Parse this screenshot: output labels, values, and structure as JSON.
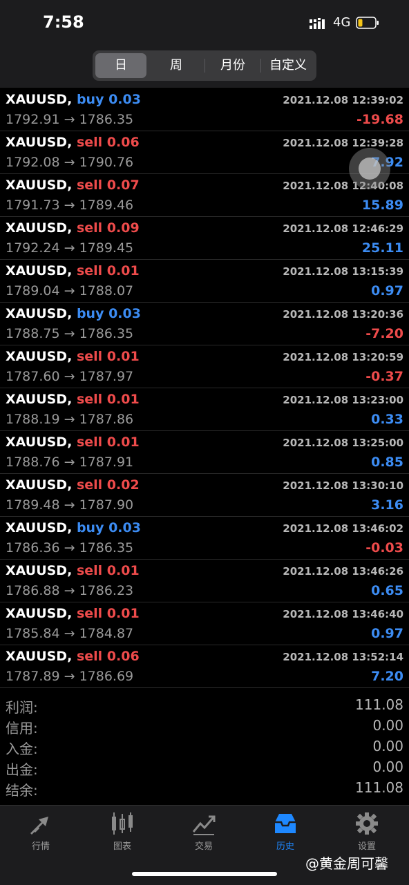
{
  "status": {
    "time": "7:58",
    "network": "4G"
  },
  "tabs_top": [
    "日",
    "周",
    "月份",
    "自定义"
  ],
  "trades": [
    {
      "symbol": "XAUUSD,",
      "side": "buy",
      "volume": "0.03",
      "time": "2021.12.08 12:39:02",
      "prices": "1792.91 → 1786.35",
      "profit": "-19.68"
    },
    {
      "symbol": "XAUUSD,",
      "side": "sell",
      "volume": "0.06",
      "time": "2021.12.08 12:39:28",
      "prices": "1792.08 → 1790.76",
      "profit": "7.92"
    },
    {
      "symbol": "XAUUSD,",
      "side": "sell",
      "volume": "0.07",
      "time": "2021.12.08 12:40:08",
      "prices": "1791.73 → 1789.46",
      "profit": "15.89"
    },
    {
      "symbol": "XAUUSD,",
      "side": "sell",
      "volume": "0.09",
      "time": "2021.12.08 12:46:29",
      "prices": "1792.24 → 1789.45",
      "profit": "25.11"
    },
    {
      "symbol": "XAUUSD,",
      "side": "sell",
      "volume": "0.01",
      "time": "2021.12.08 13:15:39",
      "prices": "1789.04 → 1788.07",
      "profit": "0.97"
    },
    {
      "symbol": "XAUUSD,",
      "side": "buy",
      "volume": "0.03",
      "time": "2021.12.08 13:20:36",
      "prices": "1788.75 → 1786.35",
      "profit": "-7.20"
    },
    {
      "symbol": "XAUUSD,",
      "side": "sell",
      "volume": "0.01",
      "time": "2021.12.08 13:20:59",
      "prices": "1787.60 → 1787.97",
      "profit": "-0.37"
    },
    {
      "symbol": "XAUUSD,",
      "side": "sell",
      "volume": "0.01",
      "time": "2021.12.08 13:23:00",
      "prices": "1788.19 → 1787.86",
      "profit": "0.33"
    },
    {
      "symbol": "XAUUSD,",
      "side": "sell",
      "volume": "0.01",
      "time": "2021.12.08 13:25:00",
      "prices": "1788.76 → 1787.91",
      "profit": "0.85"
    },
    {
      "symbol": "XAUUSD,",
      "side": "sell",
      "volume": "0.02",
      "time": "2021.12.08 13:30:10",
      "prices": "1789.48 → 1787.90",
      "profit": "3.16"
    },
    {
      "symbol": "XAUUSD,",
      "side": "buy",
      "volume": "0.03",
      "time": "2021.12.08 13:46:02",
      "prices": "1786.36 → 1786.35",
      "profit": "-0.03"
    },
    {
      "symbol": "XAUUSD,",
      "side": "sell",
      "volume": "0.01",
      "time": "2021.12.08 13:46:26",
      "prices": "1786.88 → 1786.23",
      "profit": "0.65"
    },
    {
      "symbol": "XAUUSD,",
      "side": "sell",
      "volume": "0.01",
      "time": "2021.12.08 13:46:40",
      "prices": "1785.84 → 1784.87",
      "profit": "0.97"
    },
    {
      "symbol": "XAUUSD,",
      "side": "sell",
      "volume": "0.06",
      "time": "2021.12.08 13:52:14",
      "prices": "1787.89 → 1786.69",
      "profit": "7.20"
    }
  ],
  "summary": [
    {
      "label": "利润:",
      "value": "111.08"
    },
    {
      "label": "信用:",
      "value": "0.00"
    },
    {
      "label": "入金:",
      "value": "0.00"
    },
    {
      "label": "出金:",
      "value": "0.00"
    },
    {
      "label": "结余:",
      "value": "111.08"
    }
  ],
  "tabbar": [
    {
      "label": "行情",
      "icon": "quotes-arrows-icon"
    },
    {
      "label": "图表",
      "icon": "candlestick-chart-icon"
    },
    {
      "label": "交易",
      "icon": "trade-line-icon"
    },
    {
      "label": "历史",
      "icon": "history-inbox-icon",
      "active": true
    },
    {
      "label": "设置",
      "icon": "gear-icon"
    }
  ],
  "watermark": "@黄金周可馨",
  "colors": {
    "buy": "#3c8cf3",
    "sell": "#ee4b4b",
    "active_tab": "#1e88ff"
  }
}
